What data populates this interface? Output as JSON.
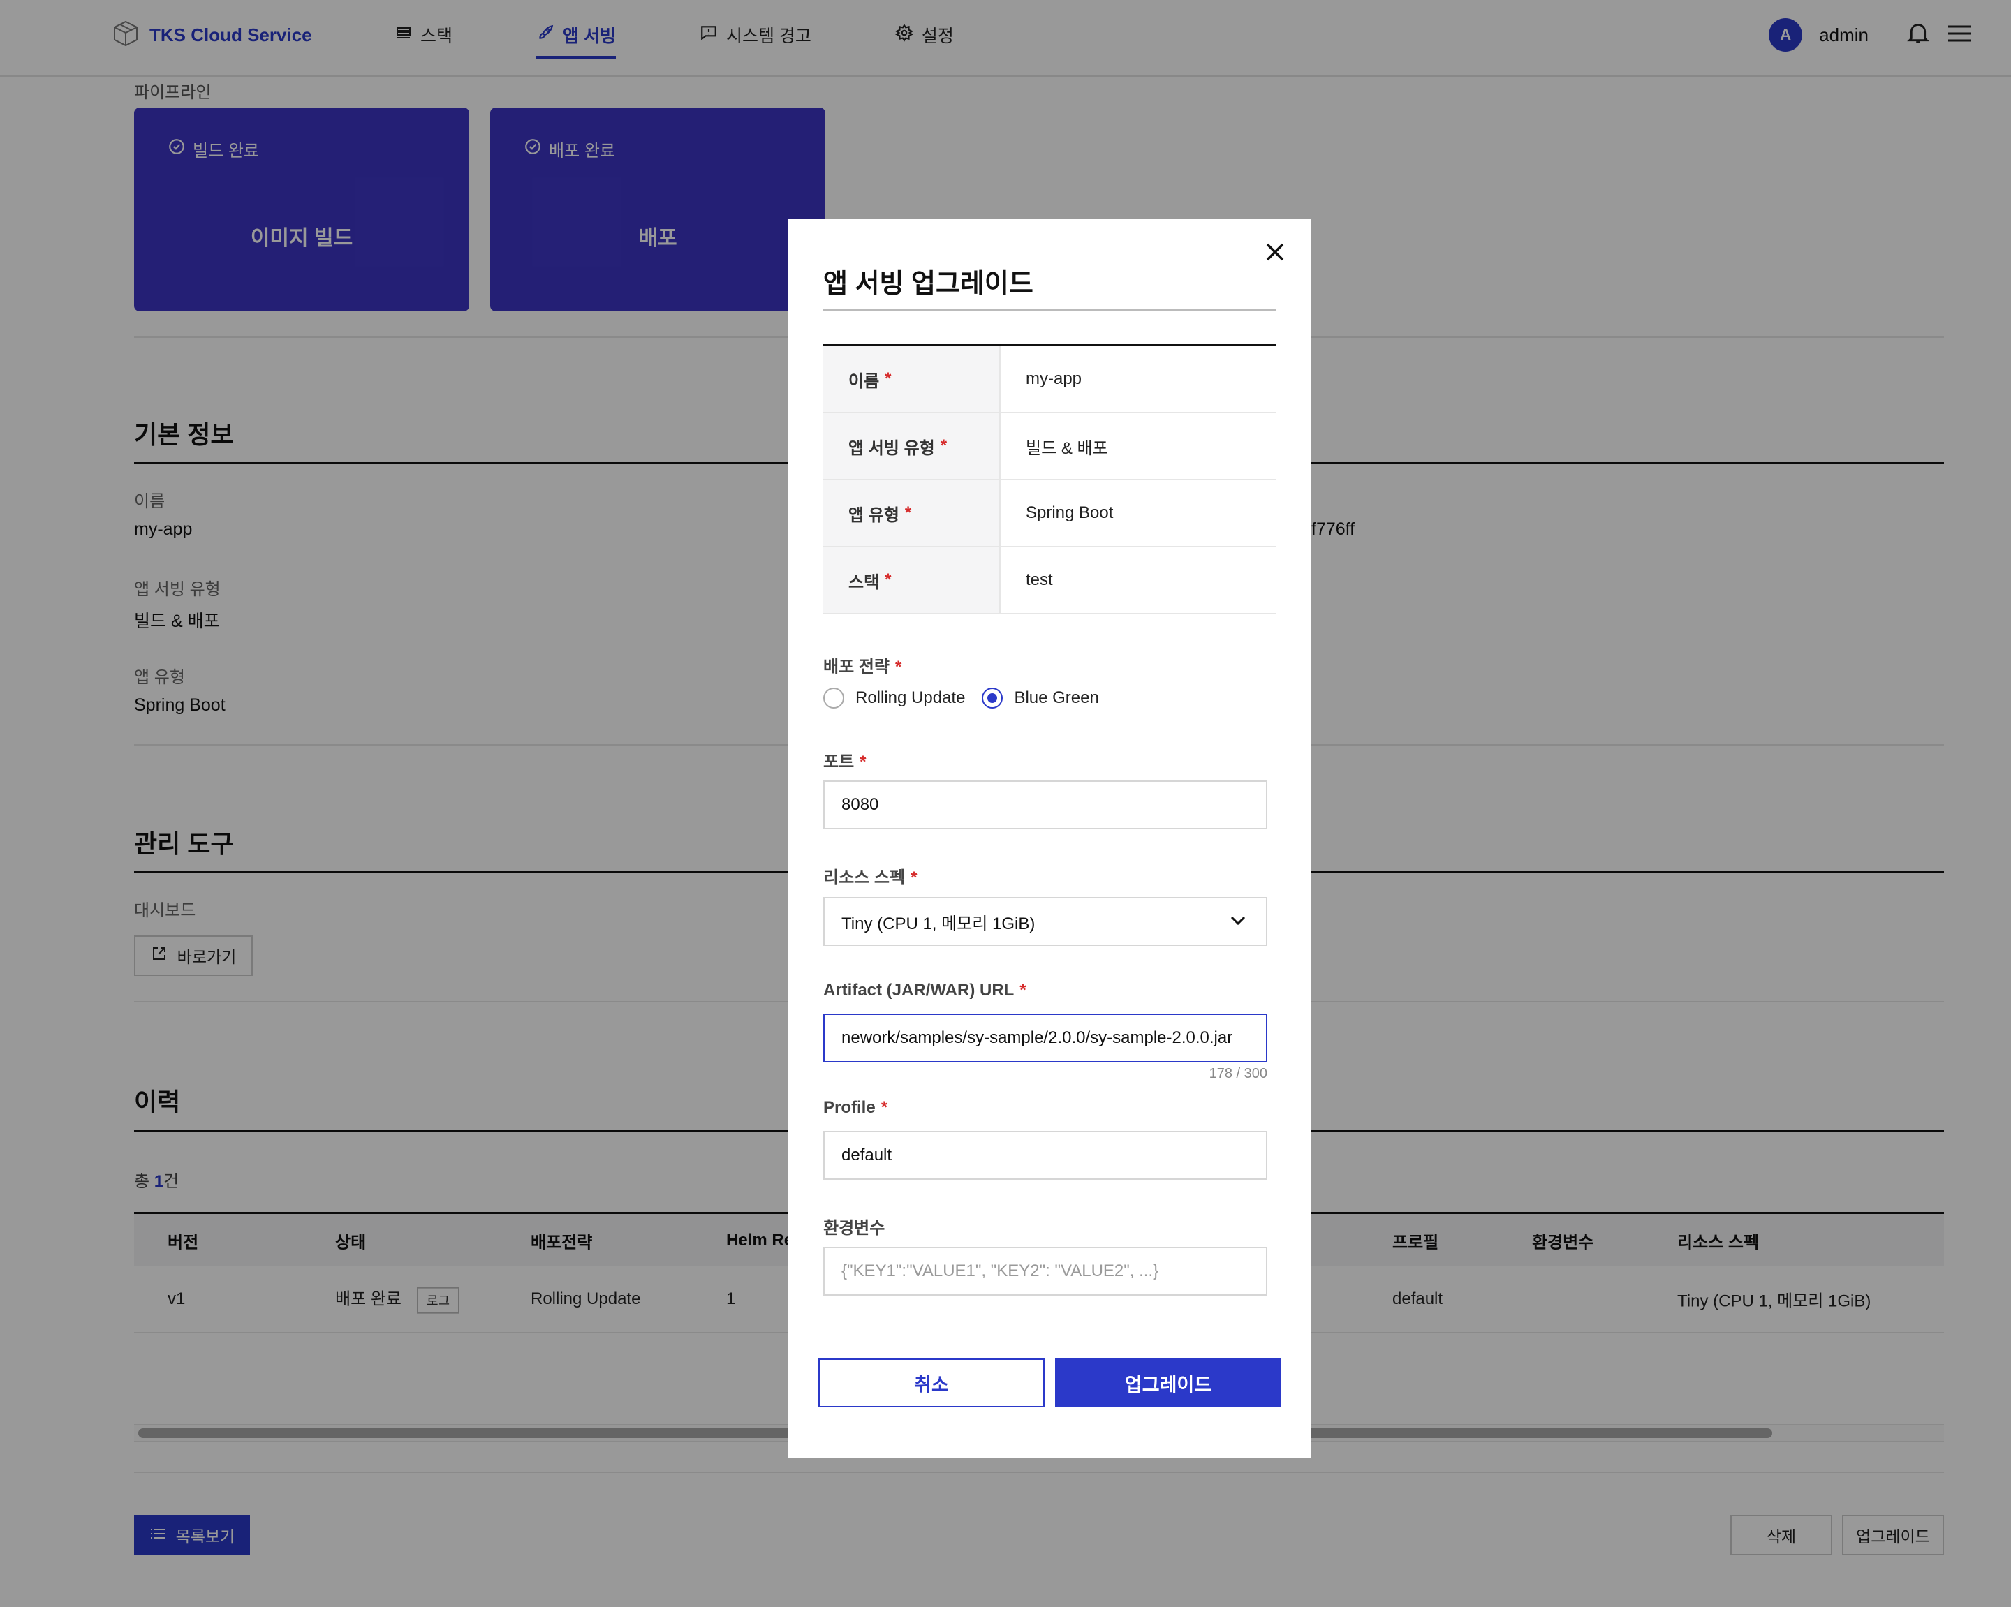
{
  "header": {
    "logo_text": "TKS Cloud Service",
    "nav": [
      {
        "label": "스택",
        "icon": "stack-icon"
      },
      {
        "label": "앱 서빙",
        "icon": "rocket-icon"
      },
      {
        "label": "시스템 경고",
        "icon": "alert-message-icon"
      },
      {
        "label": "설정",
        "icon": "gear-icon"
      }
    ],
    "avatar_letter": "A",
    "username": "admin"
  },
  "pipeline": {
    "label": "파이프라인",
    "stages": [
      {
        "status": "빌드 완료",
        "name": "이미지 빌드"
      },
      {
        "status": "배포 완료",
        "name": "배포"
      }
    ]
  },
  "basic_info": {
    "title": "기본 정보",
    "fields": [
      {
        "label": "이름",
        "value": "my-app"
      },
      {
        "label": "앱 서빙 유형",
        "value": "빌드 & 배포"
      },
      {
        "label": "앱 유형",
        "value": "Spring Boot"
      }
    ],
    "partial_value": "f776ff"
  },
  "tools": {
    "title": "관리 도구",
    "dashboard_label": "대시보드",
    "shortcut_label": "바로가기"
  },
  "history": {
    "title": "이력",
    "total_prefix": "총 ",
    "total_count": "1",
    "total_suffix": "건",
    "columns": [
      "버전",
      "상태",
      "배포전략",
      "Helm Re",
      "프로필",
      "환경변수",
      "리소스 스펙"
    ],
    "rows": [
      {
        "version": "v1",
        "status": "배포 완료",
        "log": "로그",
        "strategy": "Rolling Update",
        "helm": "1",
        "profile": "default",
        "env": "",
        "spec": "Tiny (CPU 1, 메모리 1GiB)"
      }
    ]
  },
  "footer": {
    "list_label": "목록보기",
    "delete_label": "삭제",
    "upgrade_label": "업그레이드"
  },
  "modal": {
    "title": "앱 서빙 업그레이드",
    "required_mark": "*",
    "info": [
      {
        "label": "이름",
        "value": "my-app"
      },
      {
        "label": "앱 서빙 유형",
        "value": "빌드 & 배포"
      },
      {
        "label": "앱 유형",
        "value": "Spring Boot"
      },
      {
        "label": "스택",
        "value": "test"
      }
    ],
    "strategy": {
      "label": "배포 전략",
      "options": [
        "Rolling Update",
        "Blue Green"
      ],
      "selected": "Blue Green"
    },
    "port": {
      "label": "포트",
      "value": "8080"
    },
    "resource": {
      "label": "리소스 스펙",
      "value": "Tiny (CPU 1, 메모리 1GiB)"
    },
    "artifact": {
      "label": "Artifact (JAR/WAR) URL",
      "value": "nework/samples/sy-sample/2.0.0/sy-sample-2.0.0.jar",
      "counter": "178 / 300"
    },
    "profile": {
      "label": "Profile",
      "value": "default"
    },
    "env": {
      "label": "환경변수",
      "placeholder": "{\"KEY1\":\"VALUE1\", \"KEY2\": \"VALUE2\", ...}"
    },
    "cancel_label": "취소",
    "submit_label": "업그레이드"
  },
  "colors": {
    "accent": "#2b39c9",
    "pipeline_stage": "#3d35c4",
    "required": "#d62b2b"
  }
}
